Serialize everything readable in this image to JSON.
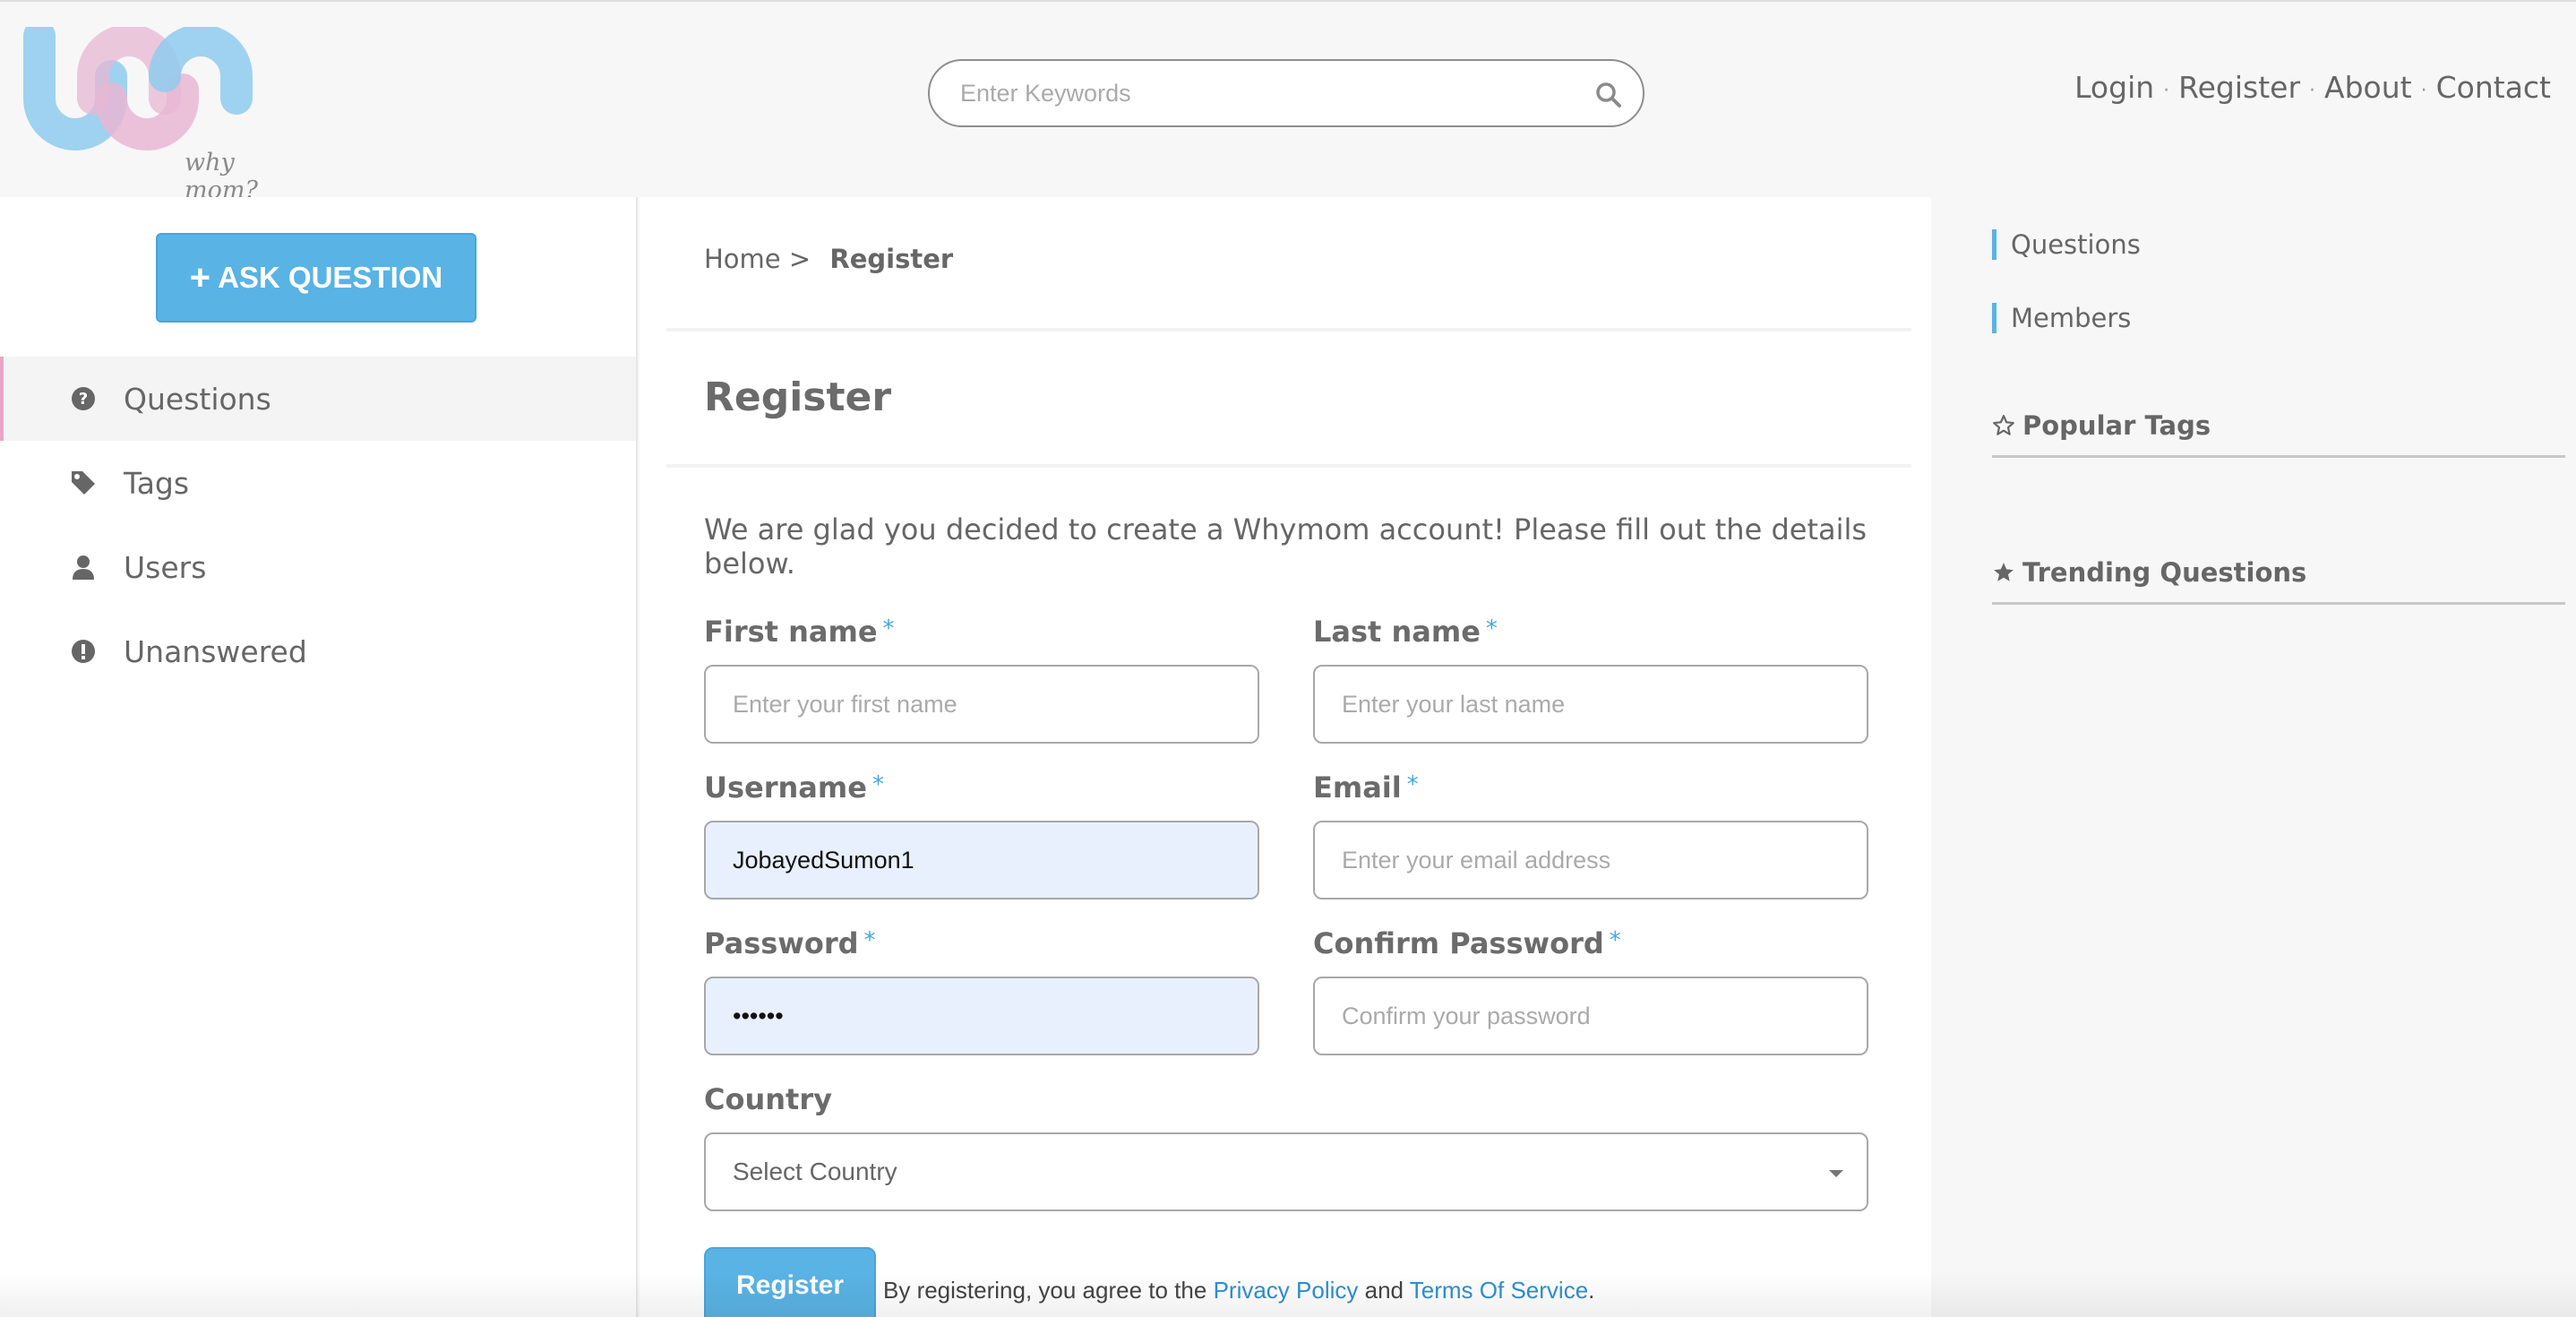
{
  "header": {
    "logo_caption": "why mom?",
    "search": {
      "placeholder": "Enter Keywords",
      "value": ""
    },
    "nav": [
      {
        "label": "Login"
      },
      {
        "label": "Register"
      },
      {
        "label": "About"
      },
      {
        "label": "Contact"
      }
    ]
  },
  "left_sidebar": {
    "ask_button": "ASK QUESTION",
    "menu": [
      {
        "label": "Questions",
        "icon": "question-circle-icon",
        "active": true
      },
      {
        "label": "Tags",
        "icon": "tag-icon",
        "active": false
      },
      {
        "label": "Users",
        "icon": "user-icon",
        "active": false
      },
      {
        "label": "Unanswered",
        "icon": "exclamation-circle-icon",
        "active": false
      }
    ]
  },
  "main": {
    "breadcrumb": {
      "home": "Home >",
      "current": "Register"
    },
    "title": "Register",
    "intro": "We are glad you decided to create a Whymom account! Please fill out the details below.",
    "form": {
      "required_mark": "*",
      "first_name": {
        "label": "First name",
        "placeholder": "Enter your first name",
        "value": ""
      },
      "last_name": {
        "label": "Last name",
        "placeholder": "Enter your last name",
        "value": ""
      },
      "username": {
        "label": "Username",
        "placeholder": "",
        "value": "JobayedSumon1"
      },
      "email": {
        "label": "Email",
        "placeholder": "Enter your email address",
        "value": ""
      },
      "password": {
        "label": "Password",
        "placeholder": "",
        "value": "••••••"
      },
      "confirm_password": {
        "label": "Confirm Password",
        "placeholder": "Confirm your password",
        "value": ""
      },
      "country": {
        "label": "Country",
        "selected": "Select Country"
      },
      "submit": "Register",
      "agree_prefix": "By registering, you agree to the",
      "privacy_link": "Privacy Policy",
      "and": "and",
      "terms_link": "Terms Of Service",
      "period": "."
    }
  },
  "right_sidebar": {
    "links": [
      {
        "label": "Questions"
      },
      {
        "label": "Members"
      }
    ],
    "popular_tags": "Popular Tags",
    "trending_questions": "Trending Questions"
  },
  "colors": {
    "accent": "#59b3e4",
    "active_border": "#e8a6c6",
    "filled_input_bg": "#e8f0fe",
    "link": "#2f8fd0"
  }
}
